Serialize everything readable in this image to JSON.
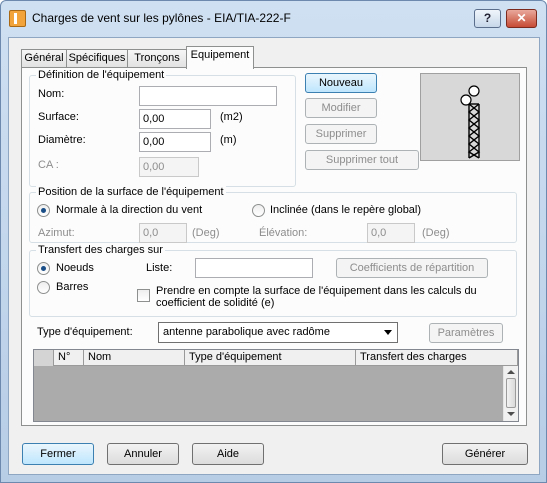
{
  "window": {
    "title": "Charges de vent sur les pylônes - EIA/TIA-222-F",
    "help_label": "?",
    "close_label": "✕"
  },
  "tabs": [
    {
      "label": "Général"
    },
    {
      "label": "Spécifiques"
    },
    {
      "label": "Tronçons"
    },
    {
      "label": "Equipement"
    }
  ],
  "definition": {
    "legend": "Définition de l'équipement",
    "nom_label": "Nom:",
    "nom_value": "",
    "surface_label": "Surface:",
    "surface_value": "0,00",
    "surface_unit": "(m2)",
    "diametre_label": "Diamètre:",
    "diametre_value": "0,00",
    "diametre_unit": "(m)",
    "ca_label": "CA :",
    "ca_value": "0,00"
  },
  "actions": {
    "nouveau": "Nouveau",
    "modifier": "Modifier",
    "supprimer": "Supprimer",
    "supprimer_tout": "Supprimer tout"
  },
  "position": {
    "legend": "Position de la surface de l'équipement",
    "normale_label": "Normale à la direction du vent",
    "inclinee_label": "Inclinée (dans le repère global)",
    "azimut_label": "Azimut:",
    "azimut_value": "0,0",
    "azimut_unit": "(Deg)",
    "elevation_label": "Élévation:",
    "elevation_value": "0,0",
    "elevation_unit": "(Deg)",
    "selected": "normale"
  },
  "transfert": {
    "legend": "Transfert des charges sur",
    "noeuds_label": "Noeuds",
    "barres_label": "Barres",
    "liste_label": "Liste:",
    "liste_value": "",
    "coefficients_label": "Coefficients de répartition",
    "prendre_label_1": "Prendre en compte la surface de l'équipement dans les calculs du",
    "prendre_label_2": "coefficient de solidité (e)",
    "prendre_checked": false,
    "selected": "noeuds"
  },
  "type_equipement": {
    "label": "Type d'équipement:",
    "value": "antenne parabolique avec radôme",
    "parametres_label": "Paramètres"
  },
  "table": {
    "columns": [
      "N°",
      "Nom",
      "Type d'équipement",
      "Transfert des charges"
    ],
    "rows": []
  },
  "footer": {
    "fermer": "Fermer",
    "annuler": "Annuler",
    "aide": "Aide",
    "generer": "Générer"
  }
}
